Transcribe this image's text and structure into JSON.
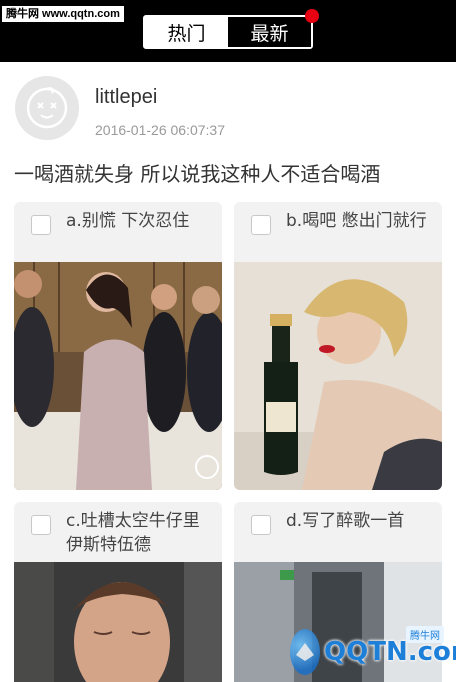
{
  "watermark_top": "腾牛网 www.qqtn.com",
  "tabs": [
    {
      "label": "热门",
      "active": true
    },
    {
      "label": "最新",
      "active": false
    }
  ],
  "notification_dot_color": "#e60012",
  "post": {
    "username": "littlepei",
    "timestamp": "2016-01-26 06:07:37",
    "question": "一喝酒就失身 所以说我这种人不适合喝酒",
    "avatar_icon": "mascot-face-icon"
  },
  "options": [
    {
      "label": "a.别慌 下次忍住",
      "image": "party-photo"
    },
    {
      "label": "b.喝吧 憋出门就行",
      "image": "champagne-bottle-photo"
    },
    {
      "label": "c.吐槽太空牛仔里伊斯特伍德",
      "image": "man-closed-eyes-photo"
    },
    {
      "label": "d.写了醉歌一首",
      "image": "train-interior-photo"
    }
  ],
  "watermark_bottom": {
    "logo_text": "QQTN.com",
    "tag": "腾牛网"
  }
}
